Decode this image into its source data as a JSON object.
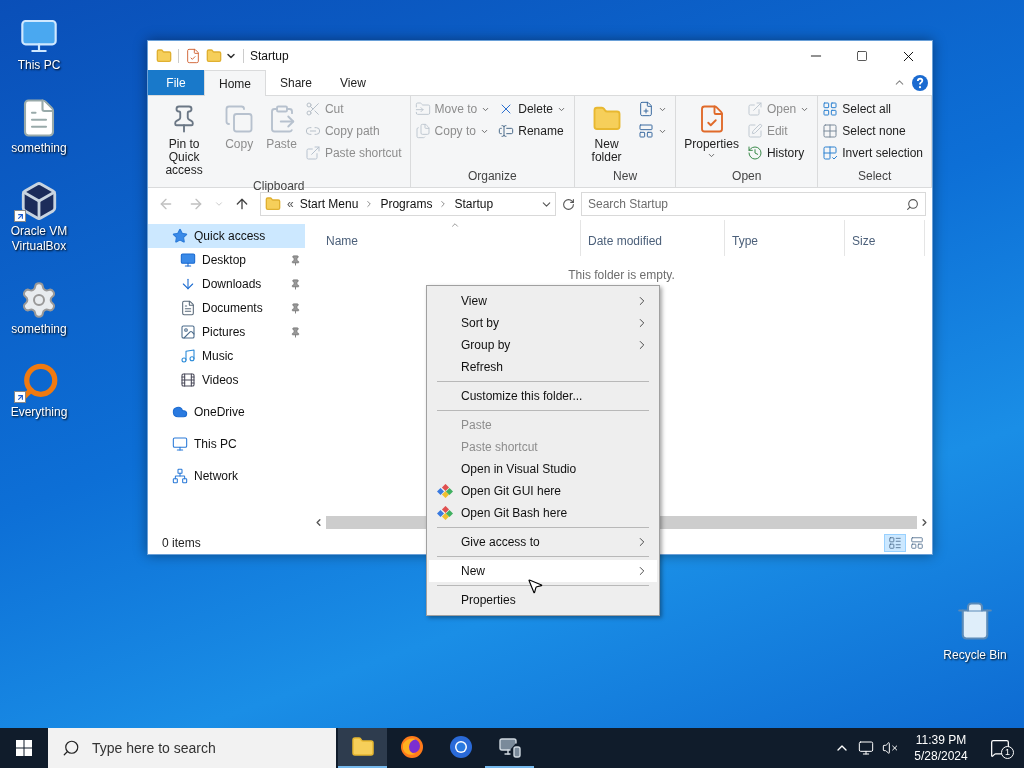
{
  "desktop_icons": [
    {
      "label": "This PC",
      "kind": "pc",
      "shortcut": false
    },
    {
      "label": "something",
      "kind": "text",
      "shortcut": false
    },
    {
      "label": "Oracle VM VirtualBox",
      "kind": "vbox",
      "shortcut": true
    },
    {
      "label": "something",
      "kind": "config",
      "shortcut": false
    },
    {
      "label": "Everything",
      "kind": "search",
      "shortcut": true
    }
  ],
  "recycle_bin": {
    "label": "Recycle Bin"
  },
  "window": {
    "title": "Startup",
    "ribbon_tabs": [
      {
        "label": "File",
        "kind": "file",
        "selected": false
      },
      {
        "label": "Home",
        "kind": "tab",
        "selected": true
      },
      {
        "label": "Share",
        "kind": "tab",
        "selected": false
      },
      {
        "label": "View",
        "kind": "tab",
        "selected": false
      }
    ],
    "ribbon_groups": [
      {
        "name": "Clipboard",
        "large": [
          {
            "label": "Pin to Quick access",
            "kind": "pin",
            "disabled": false,
            "menu": false
          },
          {
            "label": "Copy",
            "kind": "copy",
            "disabled": true,
            "menu": false
          },
          {
            "label": "Paste",
            "kind": "paste",
            "disabled": true,
            "menu": false
          }
        ],
        "small_columns": [
          [
            {
              "label": "Cut",
              "kind": "cut",
              "disabled": true,
              "menu": false
            },
            {
              "label": "Copy path",
              "kind": "path",
              "disabled": true,
              "menu": false
            },
            {
              "label": "Paste shortcut",
              "kind": "shortcut",
              "disabled": true,
              "menu": false
            }
          ]
        ]
      },
      {
        "name": "Organize",
        "small_columns": [
          [
            {
              "label": "Move to",
              "kind": "move",
              "disabled": true,
              "menu": true
            },
            {
              "label": "Copy to",
              "kind": "copyto",
              "disabled": true,
              "menu": true
            }
          ],
          [
            {
              "label": "Delete",
              "kind": "delete",
              "disabled": false,
              "menu": true
            },
            {
              "label": "Rename",
              "kind": "rename",
              "disabled": false,
              "menu": false
            }
          ]
        ]
      },
      {
        "name": "New",
        "large": [
          {
            "label": "New folder",
            "kind": "folder",
            "disabled": false,
            "menu": false
          }
        ],
        "small_columns": [
          [
            {
              "kind": "newitem",
              "disabled": false,
              "menu": true
            },
            {
              "kind": "easyaccess",
              "disabled": false,
              "menu": true
            }
          ]
        ]
      },
      {
        "name": "Open",
        "large": [
          {
            "label": "Properties",
            "kind": "properties",
            "disabled": false,
            "menu": true
          }
        ],
        "small_columns": [
          [
            {
              "label": "Open",
              "kind": "open",
              "disabled": true,
              "menu": true
            },
            {
              "label": "Edit",
              "kind": "edit",
              "disabled": true,
              "menu": false
            },
            {
              "label": "History",
              "kind": "history",
              "disabled": false,
              "menu": false
            }
          ]
        ]
      },
      {
        "name": "Select",
        "small_columns": [
          [
            {
              "label": "Select all",
              "kind": "all",
              "disabled": false,
              "menu": false
            },
            {
              "label": "Select none",
              "kind": "none",
              "disabled": false,
              "menu": false
            },
            {
              "label": "Invert selection",
              "kind": "invert",
              "disabled": false,
              "menu": false
            }
          ]
        ]
      }
    ],
    "address": {
      "overflow_mark": "«",
      "path": [
        "Start Menu",
        "Programs",
        "Startup"
      ],
      "search_placeholder": "Search Startup"
    },
    "nav": [
      {
        "label": "Quick access",
        "kind": "star",
        "selected": true,
        "children": [
          {
            "label": "Desktop",
            "kind": "desktop",
            "pinned": true,
            "selected": false
          },
          {
            "label": "Downloads",
            "kind": "download",
            "pinned": true,
            "selected": false
          },
          {
            "label": "Documents",
            "kind": "document",
            "pinned": true,
            "selected": false
          },
          {
            "label": "Pictures",
            "kind": "picture",
            "pinned": true,
            "selected": false
          },
          {
            "label": "Music",
            "kind": "music",
            "pinned": false,
            "selected": false
          },
          {
            "label": "Videos",
            "kind": "video",
            "pinned": false,
            "selected": false
          }
        ]
      },
      {
        "label": "OneDrive",
        "kind": "cloud",
        "selected": false
      },
      {
        "label": "This PC",
        "kind": "pc",
        "selected": false
      },
      {
        "label": "Network",
        "kind": "network",
        "selected": false
      }
    ],
    "columns": [
      {
        "label": "Name",
        "sorted": true
      },
      {
        "label": "Date modified",
        "sorted": false
      },
      {
        "label": "Type",
        "sorted": false
      },
      {
        "label": "Size",
        "sorted": false
      }
    ],
    "empty_message": "This folder is empty.",
    "status": "0 items",
    "views": [
      {
        "kind": "details",
        "selected": true
      },
      {
        "kind": "tiles",
        "selected": false
      }
    ]
  },
  "context_menu": [
    {
      "label": "View",
      "kind": "submenu",
      "disabled": false,
      "selected": false
    },
    {
      "label": "Sort by",
      "kind": "submenu",
      "disabled": false,
      "selected": false
    },
    {
      "label": "Group by",
      "kind": "submenu",
      "disabled": false,
      "selected": false
    },
    {
      "label": "Refresh",
      "kind": "item",
      "disabled": false,
      "selected": false
    },
    {
      "kind": "separator"
    },
    {
      "label": "Customize this folder...",
      "kind": "item",
      "disabled": false,
      "selected": false
    },
    {
      "kind": "separator"
    },
    {
      "label": "Paste",
      "kind": "item",
      "disabled": true,
      "selected": false
    },
    {
      "label": "Paste shortcut",
      "kind": "item",
      "disabled": true,
      "selected": false
    },
    {
      "label": "Open in Visual Studio",
      "kind": "item",
      "disabled": false,
      "selected": false
    },
    {
      "label": "Open Git GUI here",
      "kind": "git",
      "disabled": false,
      "selected": false
    },
    {
      "label": "Open Git Bash here",
      "kind": "git",
      "disabled": false,
      "selected": false
    },
    {
      "kind": "separator"
    },
    {
      "label": "Give access to",
      "kind": "submenu",
      "disabled": false,
      "selected": false
    },
    {
      "kind": "separator"
    },
    {
      "label": "New",
      "kind": "submenu",
      "disabled": false,
      "selected": true
    },
    {
      "kind": "separator"
    },
    {
      "label": "Properties",
      "kind": "item",
      "disabled": false,
      "selected": false
    }
  ],
  "taskbar": {
    "search_placeholder": "Type here to search",
    "apps": [
      {
        "kind": "explorer",
        "active": true,
        "running": true
      },
      {
        "kind": "firefox",
        "active": false,
        "running": false
      },
      {
        "kind": "chrome",
        "active": false,
        "running": false
      },
      {
        "kind": "remote",
        "active": false,
        "running": true
      }
    ],
    "time": "11:39 PM",
    "date": "5/28/2024",
    "notifications": "1"
  }
}
